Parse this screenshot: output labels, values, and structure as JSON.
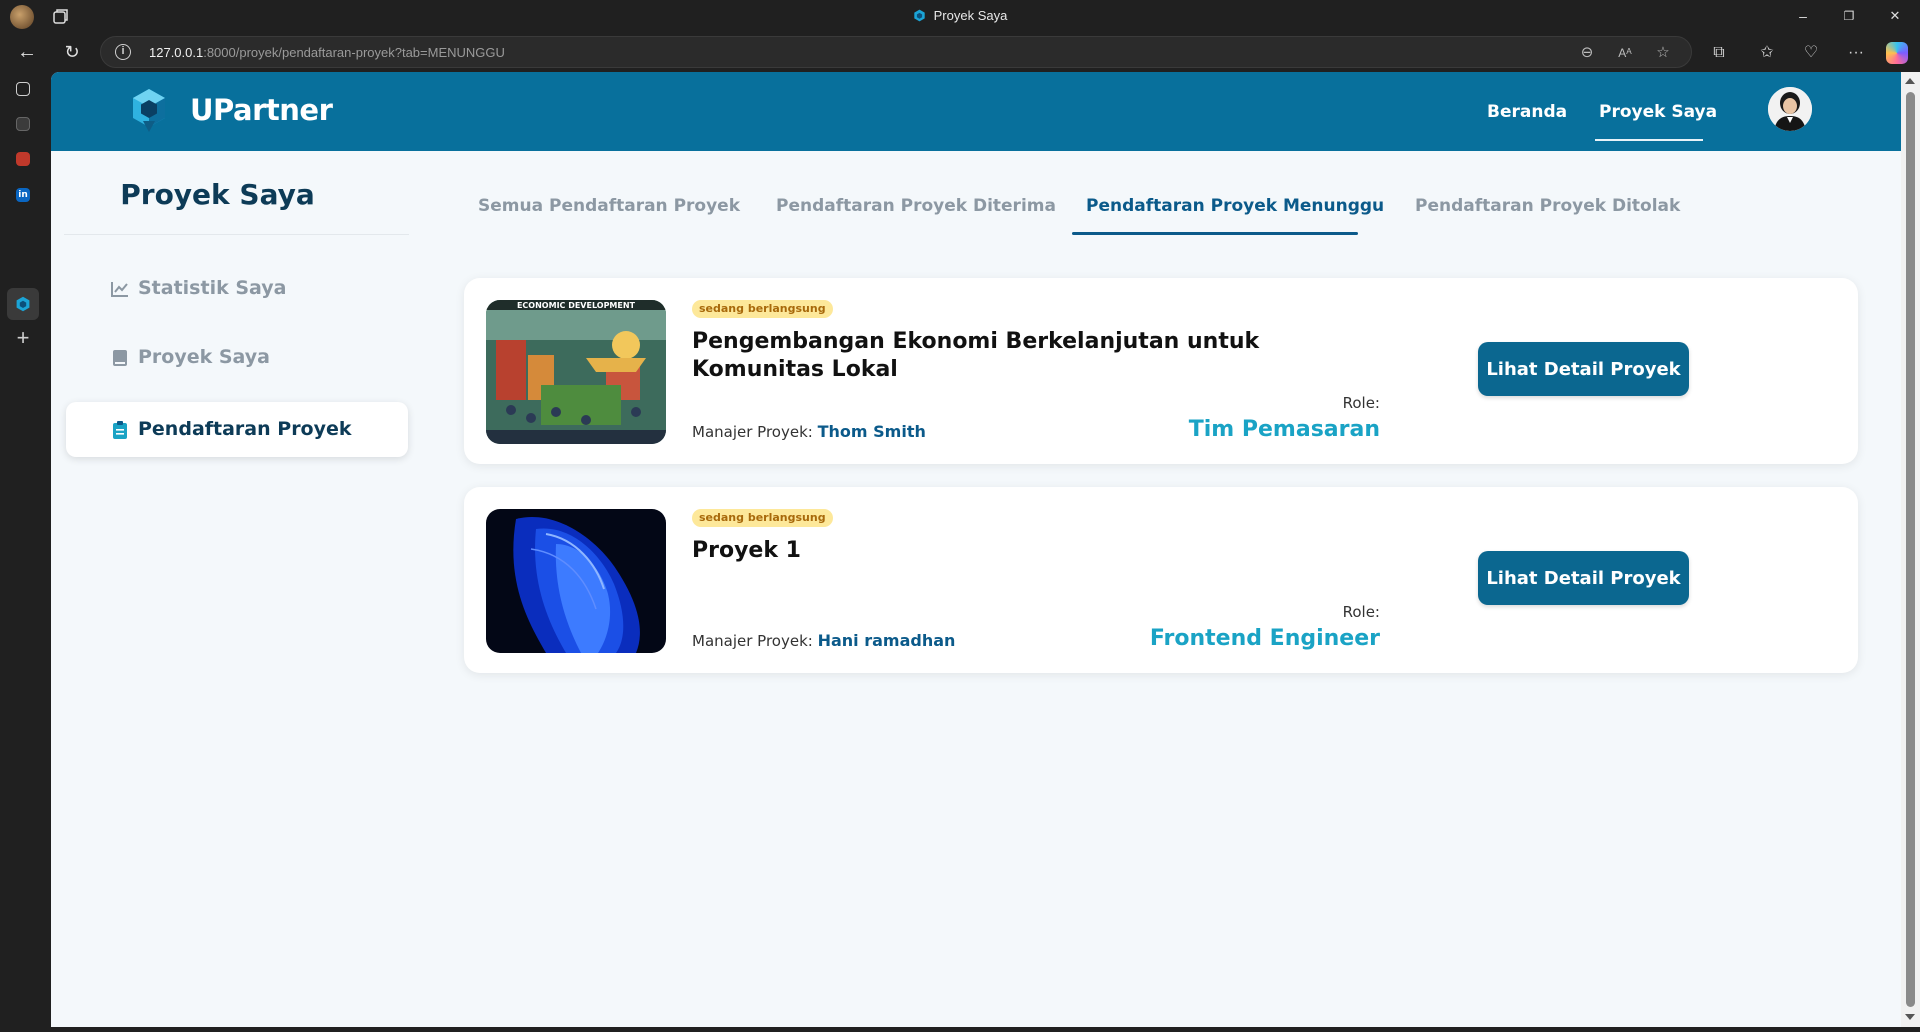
{
  "browser": {
    "tab_title": "Proyek Saya",
    "url_host": "127.0.0.1",
    "url_rest": ":8000/proyek/pendaftaran-proyek?tab=MENUNGGU",
    "window_controls": {
      "minimize": "–",
      "restore": "❐",
      "close": "✕"
    }
  },
  "header": {
    "brand": "UPartner",
    "nav": [
      {
        "label": "Beranda"
      },
      {
        "label": "Proyek Saya",
        "active": true
      }
    ]
  },
  "sidebar": {
    "title": "Proyek Saya",
    "items": [
      {
        "label": "Statistik Saya",
        "icon": "chart-line-icon"
      },
      {
        "label": "Proyek Saya",
        "icon": "book-icon"
      },
      {
        "label": "Pendaftaran Proyek",
        "icon": "clipboard-icon",
        "active": true
      }
    ]
  },
  "tabs": [
    {
      "label": "Semua Pendaftaran Proyek"
    },
    {
      "label": "Pendaftaran Proyek Diterima"
    },
    {
      "label": "Pendaftaran Proyek Menunggu",
      "active": true
    },
    {
      "label": "Pendaftaran Proyek Ditolak"
    }
  ],
  "projects": [
    {
      "status": "sedang berlangsung",
      "title": "Pengembangan Ekonomi Berkelanjutan untuk Komunitas Lokal",
      "manager_label": "Manajer Proyek:",
      "manager_name": "Thom Smith",
      "role_label": "Role:",
      "role": "Tim Pemasaran",
      "button": "Lihat Detail Proyek",
      "image_caption": "ECONOMIC DEVELOPMENT"
    },
    {
      "status": "sedang berlangsung",
      "title": "Proyek 1",
      "manager_label": "Manajer Proyek:",
      "manager_name": "Hani ramadhan",
      "role_label": "Role:",
      "role": "Frontend Engineer",
      "button": "Lihat Detail Proyek"
    }
  ],
  "colors": {
    "header_bg": "#08709c",
    "primary": "#0b5a8a",
    "role_accent": "#1aa3c5",
    "badge_bg": "#fde89a"
  }
}
